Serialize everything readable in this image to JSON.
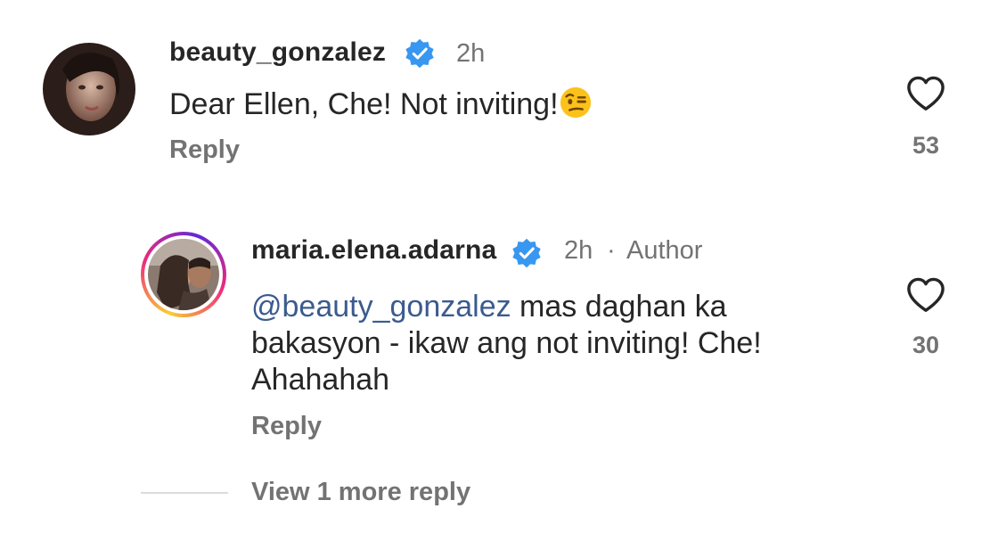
{
  "comments": [
    {
      "username": "beauty_gonzalez",
      "verified": true,
      "time": "2h",
      "author_tag": "",
      "text": "Dear Ellen, Che! Not inviting!",
      "emoji": "unamused-raised-eyebrow-emoji",
      "reply_label": "Reply",
      "likes": "53",
      "avatar": "avatar-photo-woman"
    },
    {
      "username": "maria.elena.adarna",
      "verified": true,
      "time": "2h",
      "author_sep": "·",
      "author_tag": "Author",
      "mention": "@beauty_gonzalez",
      "text_line1_rest": " mas daghan ka",
      "text_line2": "bakasyon - ikaw ang not inviting! Che!",
      "text_line3": "Ahahahah",
      "reply_label": "Reply",
      "likes": "30",
      "avatar": "avatar-photo-couple-story-ring"
    }
  ],
  "view_more_label": "View 1 more reply",
  "colors": {
    "verified_badge": "#3897f0",
    "mention": "#3b5b8f",
    "secondary_text": "#737373",
    "primary_text": "#262626",
    "story_ring_start": "#f9ce34",
    "story_ring_mid": "#ee2a7b",
    "story_ring_end": "#6228d7"
  },
  "icons": {
    "like": "heart-outline-icon",
    "verified": "verified-badge-icon"
  }
}
